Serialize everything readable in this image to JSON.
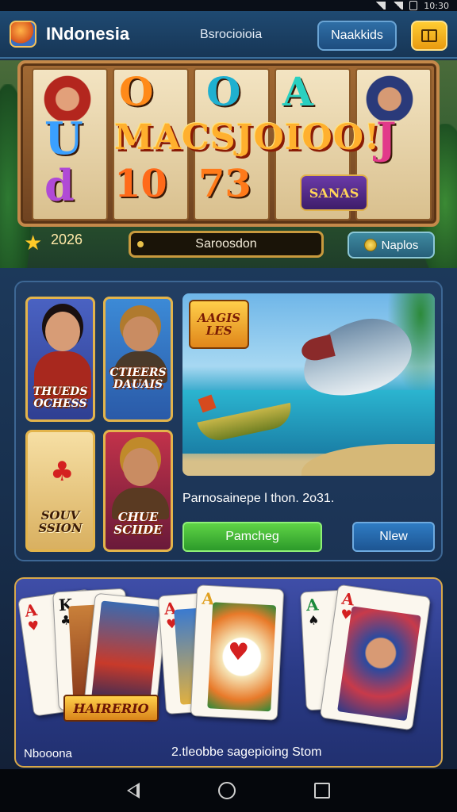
{
  "status": {
    "time": "10:30"
  },
  "header": {
    "title": "INdonesia",
    "center_text": "Bsrocioioia",
    "button_label": "Naakkids"
  },
  "banner": {
    "reel_symbols": [
      "U",
      "d",
      "O",
      "10",
      "O",
      "73",
      "A",
      "J"
    ],
    "jackpot_text": "MACSJOIOO!",
    "badge_text": "SANAS",
    "year_label": "2026",
    "progress_label": "Saroosdon",
    "coins_label": "Naplos"
  },
  "games": {
    "tiles": [
      {
        "label": "THUEDS\nOCHESS"
      },
      {
        "label": "CTIEERS\nDAUAIS"
      },
      {
        "label": "SOUV\nSSION"
      },
      {
        "label": "CHUE\nSCIIDE"
      }
    ],
    "featured_logo": "AAGIS\nLES",
    "caption": "Parnosainepe l thon. 2o31.",
    "play_label": "Pamcheg",
    "view_label": "Nlew"
  },
  "cards": {
    "hands_label": "HAIRERIO",
    "left_label": "Nbooona",
    "right_label": "2.tleobbe sagepioing Stom"
  },
  "colors": {
    "accent_gold": "#e3b44b",
    "play_green": "#3fb83a",
    "view_blue": "#2f7cc4"
  }
}
